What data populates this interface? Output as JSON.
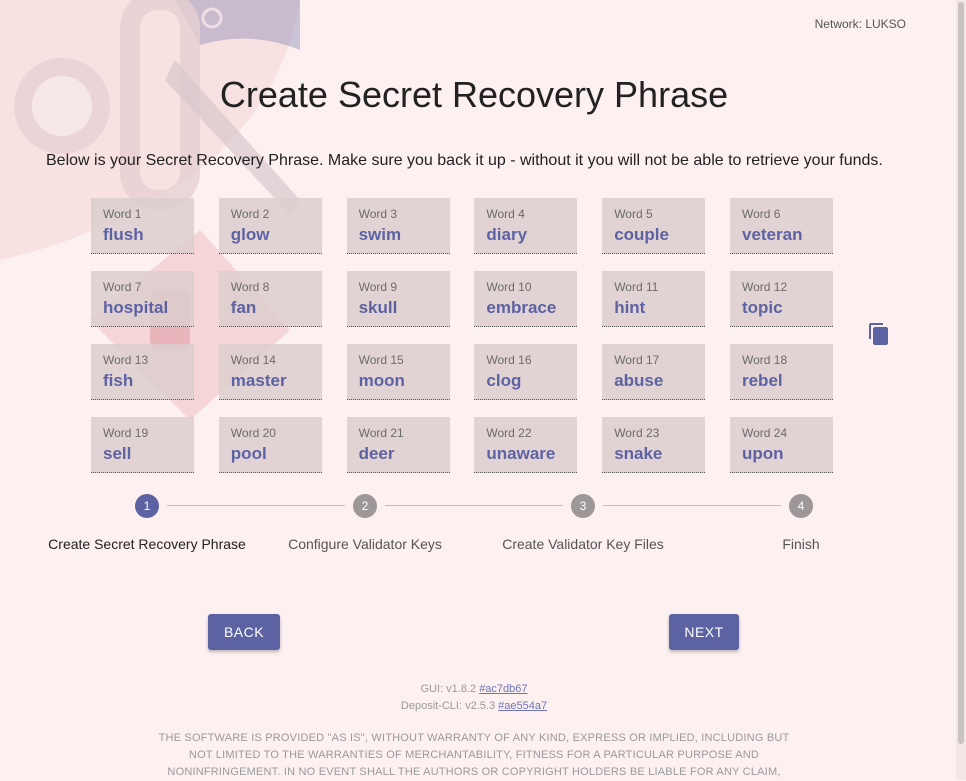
{
  "network_label": "Network: LUKSO",
  "title": "Create Secret Recovery Phrase",
  "subtitle": "Below is your Secret Recovery Phrase. Make sure you back it up - without it you will not be able to retrieve your funds.",
  "words": [
    {
      "label": "Word 1",
      "value": "flush"
    },
    {
      "label": "Word 2",
      "value": "glow"
    },
    {
      "label": "Word 3",
      "value": "swim"
    },
    {
      "label": "Word 4",
      "value": "diary"
    },
    {
      "label": "Word 5",
      "value": "couple"
    },
    {
      "label": "Word 6",
      "value": "veteran"
    },
    {
      "label": "Word 7",
      "value": "hospital"
    },
    {
      "label": "Word 8",
      "value": "fan"
    },
    {
      "label": "Word 9",
      "value": "skull"
    },
    {
      "label": "Word 10",
      "value": "embrace"
    },
    {
      "label": "Word 11",
      "value": "hint"
    },
    {
      "label": "Word 12",
      "value": "topic"
    },
    {
      "label": "Word 13",
      "value": "fish"
    },
    {
      "label": "Word 14",
      "value": "master"
    },
    {
      "label": "Word 15",
      "value": "moon"
    },
    {
      "label": "Word 16",
      "value": "clog"
    },
    {
      "label": "Word 17",
      "value": "abuse"
    },
    {
      "label": "Word 18",
      "value": "rebel"
    },
    {
      "label": "Word 19",
      "value": "sell"
    },
    {
      "label": "Word 20",
      "value": "pool"
    },
    {
      "label": "Word 21",
      "value": "deer"
    },
    {
      "label": "Word 22",
      "value": "unaware"
    },
    {
      "label": "Word 23",
      "value": "snake"
    },
    {
      "label": "Word 24",
      "value": "upon"
    }
  ],
  "copy_icon": "copy-icon",
  "stepper": {
    "active_step": 1,
    "steps": [
      {
        "number": "1",
        "label": "Create Secret Recovery Phrase"
      },
      {
        "number": "2",
        "label": "Configure Validator Keys"
      },
      {
        "number": "3",
        "label": "Create Validator Key Files"
      },
      {
        "number": "4",
        "label": "Finish"
      }
    ]
  },
  "buttons": {
    "back": "BACK",
    "next": "NEXT"
  },
  "versions": {
    "gui_prefix": "GUI: v1.8.2",
    "gui_hash": "#ac7db67",
    "cli_prefix": "Deposit-CLI: v2.5.3",
    "cli_hash": "#ae554a7"
  },
  "license_lines": [
    "THE SOFTWARE IS PROVIDED \"AS IS\", WITHOUT WARRANTY OF ANY KIND, EXPRESS OR IMPLIED, INCLUDING BUT",
    "NOT LIMITED TO THE WARRANTIES OF MERCHANTABILITY, FITNESS FOR A PARTICULAR PURPOSE AND",
    "NONINFRINGEMENT. IN NO EVENT SHALL THE AUTHORS OR COPYRIGHT HOLDERS BE LIABLE FOR ANY CLAIM,"
  ],
  "colors": {
    "accent": "#5d62a3",
    "background": "#fcf0f0",
    "word_card": "#dccece",
    "inactive_step": "#9e9797"
  }
}
